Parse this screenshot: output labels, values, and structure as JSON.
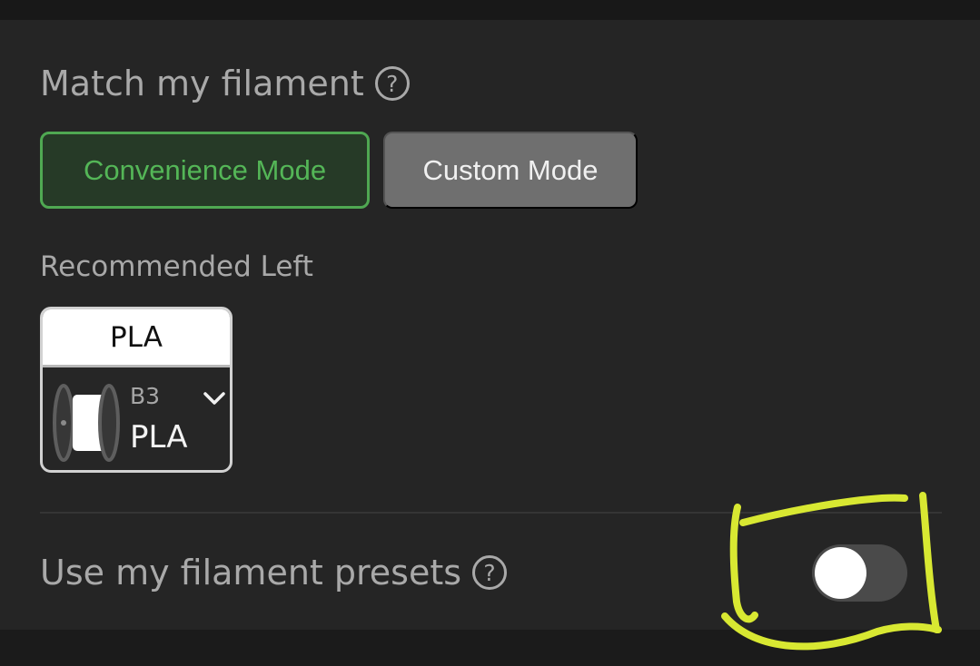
{
  "filament_match": {
    "title": "Match my filament",
    "help_icon": "question-circle-icon",
    "modes": [
      {
        "label": "Convenience Mode",
        "selected": true
      },
      {
        "label": "Custom Mode",
        "selected": false
      }
    ],
    "recommended_label": "Recommended Left",
    "card": {
      "header": "PLA",
      "slot": "B3",
      "filament": "PLA",
      "spool_icon": "filament-spool-icon",
      "dropdown_icon": "chevron-down-icon"
    }
  },
  "presets": {
    "label": "Use my filament presets",
    "help_icon": "question-circle-icon",
    "toggle_on": false
  },
  "colors": {
    "panel_background": "#252525",
    "accent_green": "#54b657",
    "annotation": "#d8e832"
  }
}
